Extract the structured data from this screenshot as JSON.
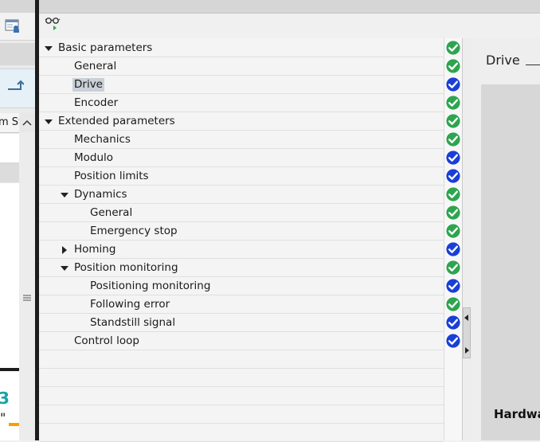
{
  "left_panel": {
    "column_header": "m Sv",
    "teal_text": "3",
    "quote_text": "\""
  },
  "tree": {
    "rows": [
      {
        "label": "Basic parameters",
        "status": "ok"
      },
      {
        "label": "General",
        "status": "ok"
      },
      {
        "label": "Drive",
        "status": "info",
        "selected": true
      },
      {
        "label": "Encoder",
        "status": "ok"
      },
      {
        "label": "Extended parameters",
        "status": "ok"
      },
      {
        "label": "Mechanics",
        "status": "ok"
      },
      {
        "label": "Modulo",
        "status": "info"
      },
      {
        "label": "Position limits",
        "status": "info"
      },
      {
        "label": "Dynamics",
        "status": "ok"
      },
      {
        "label": "General",
        "status": "ok"
      },
      {
        "label": "Emergency stop",
        "status": "ok"
      },
      {
        "label": "Homing",
        "status": "info"
      },
      {
        "label": "Position monitoring",
        "status": "ok"
      },
      {
        "label": "Positioning monitoring",
        "status": "info"
      },
      {
        "label": "Following error",
        "status": "ok"
      },
      {
        "label": "Standstill signal",
        "status": "info"
      },
      {
        "label": "Control loop",
        "status": "info"
      }
    ]
  },
  "right_panel": {
    "title": "Drive",
    "section": "Hardwa"
  },
  "colors": {
    "ok": "#2ea44f",
    "info": "#1a3fd6",
    "selected": "#c9d0d8"
  },
  "icons": {
    "toolbar": "glasses-icon",
    "window": "window-icon",
    "back": "back-arrow-icon"
  }
}
